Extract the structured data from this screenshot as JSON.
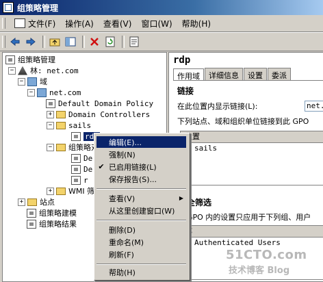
{
  "window": {
    "title": "组策略管理"
  },
  "menubar": {
    "items": [
      {
        "label": "文件(F)"
      },
      {
        "label": "操作(A)"
      },
      {
        "label": "查看(V)"
      },
      {
        "label": "窗口(W)"
      },
      {
        "label": "帮助(H)"
      }
    ]
  },
  "toolbar": {
    "buttons": [
      "back-arrow-icon",
      "forward-arrow-icon",
      "up-folder-icon",
      "show-hide-tree-icon",
      "delete-icon",
      "refresh-icon",
      "properties-icon"
    ]
  },
  "tree": {
    "root": "组策略管理",
    "forest": "林: net.com",
    "domains": "域",
    "domain": "net.com",
    "default_policy": "Default Domain Policy",
    "domain_controllers": "Domain Controllers",
    "ou_sails": "sails",
    "gpo_selected": "rdp",
    "gpo_container": "组策略对象",
    "gpo_item1": "De",
    "gpo_item2": "De",
    "gpo_item3": "r",
    "wmi": "WMI 筛选",
    "sites": "站点",
    "modeling": "组策略建模",
    "results": "组策略结果"
  },
  "right_pane": {
    "title": "rdp",
    "tabs": [
      "作用域",
      "详细信息",
      "设置",
      "委派"
    ],
    "links_heading": "链接",
    "location_label": "在此位置内显示链接(L):",
    "location_value": "net.c",
    "links_desc": "下列站点、域和组织单位链接到此 GPO",
    "links_col": "位置",
    "links_rows": [
      "sails"
    ],
    "filter_heading": "全筛选",
    "filter_desc": "GPO 内的设置只应用于下列组、用户",
    "filter_col": "称",
    "filter_rows": [
      "Authenticated Users"
    ]
  },
  "context_menu": {
    "items": [
      {
        "label": "编辑(E)...",
        "checked": false,
        "submenu": false,
        "highlight": true
      },
      {
        "label": "强制(N)",
        "checked": false,
        "submenu": false
      },
      {
        "label": "已启用链接(L)",
        "checked": true,
        "submenu": false
      },
      {
        "label": "保存报告(S)...",
        "checked": false,
        "submenu": false
      },
      {
        "sep": true
      },
      {
        "label": "查看(V)",
        "checked": false,
        "submenu": true
      },
      {
        "label": "从这里创建窗口(W)",
        "checked": false,
        "submenu": false
      },
      {
        "sep": true
      },
      {
        "label": "删除(D)",
        "checked": false,
        "submenu": false
      },
      {
        "label": "重命名(M)",
        "checked": false,
        "submenu": false
      },
      {
        "label": "刷新(F)",
        "checked": false,
        "submenu": false
      },
      {
        "sep": true
      },
      {
        "label": "帮助(H)",
        "checked": false,
        "submenu": false
      }
    ]
  },
  "watermark": {
    "line1": "51CTO.com",
    "line2": "技术博客 Blog"
  },
  "colors": {
    "titlebar": "#0a246a",
    "highlight": "#0a246a",
    "face": "#d4d0c8"
  }
}
